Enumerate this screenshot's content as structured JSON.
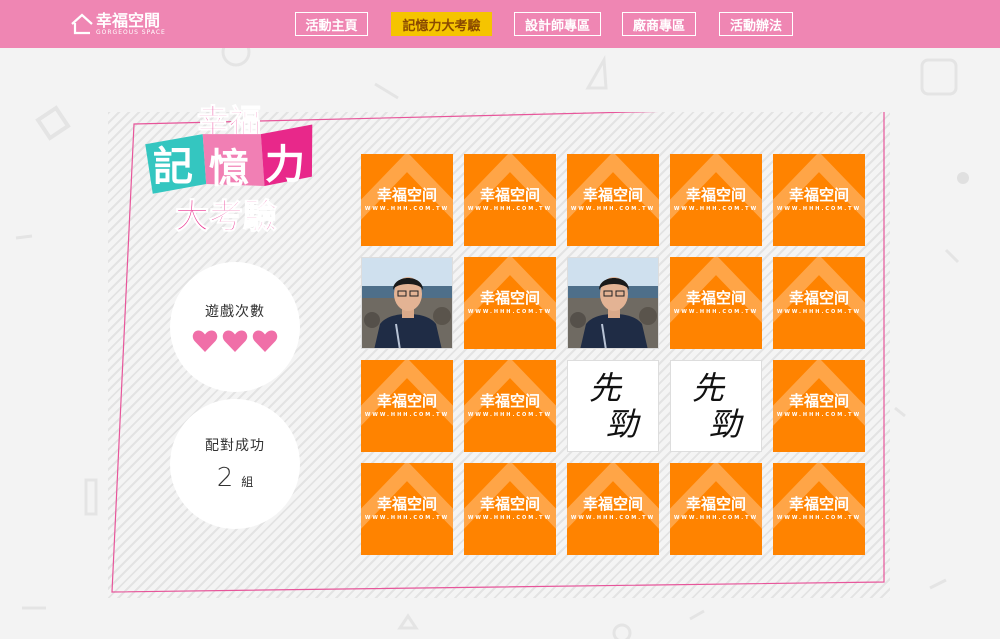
{
  "header": {
    "logo_main": "幸福空間",
    "logo_sub": "GORGEOUS SPACE",
    "nav": [
      {
        "label": "活動主頁",
        "active": false
      },
      {
        "label": "記憶力大考驗",
        "active": true
      },
      {
        "label": "設計師專區",
        "active": false
      },
      {
        "label": "廠商專區",
        "active": false
      },
      {
        "label": "活動辦法",
        "active": false
      }
    ]
  },
  "title": {
    "line1": "幸福",
    "line2_chars": [
      "記",
      "憶",
      "力"
    ],
    "line3": "大考驗"
  },
  "stats": {
    "plays_label": "遊戲次數",
    "hearts": 3,
    "match_label": "配對成功",
    "match_count": "2",
    "match_unit": "組"
  },
  "card_back": {
    "brand": "幸福空间",
    "url": "WWW.HHH.COM.TW"
  },
  "cards": [
    {
      "row": 0,
      "col": 0,
      "state": "back"
    },
    {
      "row": 0,
      "col": 1,
      "state": "back"
    },
    {
      "row": 0,
      "col": 2,
      "state": "back"
    },
    {
      "row": 0,
      "col": 3,
      "state": "back"
    },
    {
      "row": 0,
      "col": 4,
      "state": "back"
    },
    {
      "row": 1,
      "col": 0,
      "state": "photo"
    },
    {
      "row": 1,
      "col": 1,
      "state": "back"
    },
    {
      "row": 1,
      "col": 2,
      "state": "photo"
    },
    {
      "row": 1,
      "col": 3,
      "state": "back"
    },
    {
      "row": 1,
      "col": 4,
      "state": "back"
    },
    {
      "row": 2,
      "col": 0,
      "state": "back"
    },
    {
      "row": 2,
      "col": 1,
      "state": "back"
    },
    {
      "row": 2,
      "col": 2,
      "state": "calligraphy",
      "text": [
        "先",
        "勁"
      ]
    },
    {
      "row": 2,
      "col": 3,
      "state": "calligraphy",
      "text": [
        "先",
        "勁"
      ]
    },
    {
      "row": 2,
      "col": 4,
      "state": "back"
    },
    {
      "row": 3,
      "col": 0,
      "state": "back"
    },
    {
      "row": 3,
      "col": 1,
      "state": "back"
    },
    {
      "row": 3,
      "col": 2,
      "state": "back"
    },
    {
      "row": 3,
      "col": 3,
      "state": "back"
    },
    {
      "row": 3,
      "col": 4,
      "state": "back"
    }
  ],
  "colors": {
    "header": "#ef86b3",
    "card_back": "#ff8300",
    "nav_active": "#f5c400",
    "heart": "#f06fa8",
    "title_pink": "#e8288a",
    "title_teal": "#34c6c0"
  }
}
